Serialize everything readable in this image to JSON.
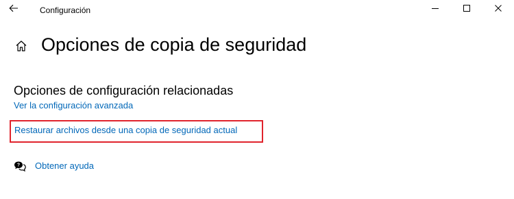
{
  "window": {
    "app_title": "Configuración",
    "controls": [
      "minimize",
      "maximize",
      "close"
    ]
  },
  "page": {
    "title": "Opciones de copia de seguridad"
  },
  "related": {
    "section_title": "Opciones de configuración relacionadas",
    "advanced_link": "Ver la configuración avanzada",
    "restore_link": "Restaurar archivos desde una copia de seguridad actual"
  },
  "help": {
    "label": "Obtener ayuda"
  },
  "colors": {
    "link": "#0067b8",
    "highlight": "#e0232c",
    "background": "#ffffff"
  },
  "icons": {
    "back": "arrow-left-icon",
    "home": "home-icon",
    "help": "chat-help-icon",
    "minimize": "minimize-icon",
    "maximize": "maximize-icon",
    "close": "close-icon"
  }
}
